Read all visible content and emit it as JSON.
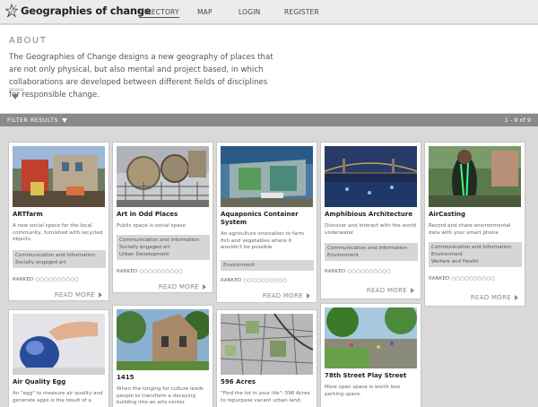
{
  "header": {
    "logo_text": "Geographies of change",
    "nav": [
      {
        "label": "DIRECTORY",
        "active": true
      },
      {
        "label": "MAP",
        "active": false
      },
      {
        "label": "LOGIN",
        "active": false
      },
      {
        "label": "REGISTER",
        "active": false
      }
    ]
  },
  "about": {
    "title": "ABOUT",
    "text": "The Geographies of Change designs a new geography of places that are not only physical, but also mental and project based, in which collaborations are developed between different fields of disciplines for responsible change.",
    "more_label": "more"
  },
  "filter": {
    "label": "FILTER RESULTS",
    "results": "1 - 9 of 9"
  },
  "ranked_label": "RANKED",
  "read_more_label": "READ MORE",
  "cards": [
    {
      "title": "ARTfarm",
      "desc": "A new social space for the local community, furnished with recycled objects",
      "tags": [
        "Communication and Information",
        "Socially engaged art"
      ]
    },
    {
      "title": "Art in Odd Places",
      "desc": "Public space is social space",
      "tags": [
        "Communication and Information",
        "Socially engaged art",
        "Urban Development"
      ]
    },
    {
      "title": "Aquaponics Container System",
      "desc": "An agriculture innovation to farm fish and vegetables where it wouldn't be possible",
      "tags": [
        "Environment"
      ]
    },
    {
      "title": "Amphibious Architecture",
      "desc": "Discover and interact with the world underwater",
      "tags": [
        "Communication and Information",
        "Environment"
      ]
    },
    {
      "title": "AirCasting",
      "desc": "Record and share environmental data with your smart phone",
      "tags": [
        "Communication and Information",
        "Environment",
        "Welfare and Health"
      ]
    },
    {
      "title": "Air Quality Egg",
      "desc": "An \"egg\" to measure air quality and generate apps is the result of a",
      "tags": []
    },
    {
      "title": "1415",
      "desc": "When the longing for culture leads people to transform a decaying building into an arts center",
      "tags": []
    },
    {
      "title": "596 Acres",
      "desc": "\"Find the lot in your life\": 596 Acres to repurpose vacant urban land,",
      "tags": []
    },
    {
      "title": "78th Street Play Street",
      "desc": "More open space is worth less parking space.",
      "tags": []
    }
  ]
}
